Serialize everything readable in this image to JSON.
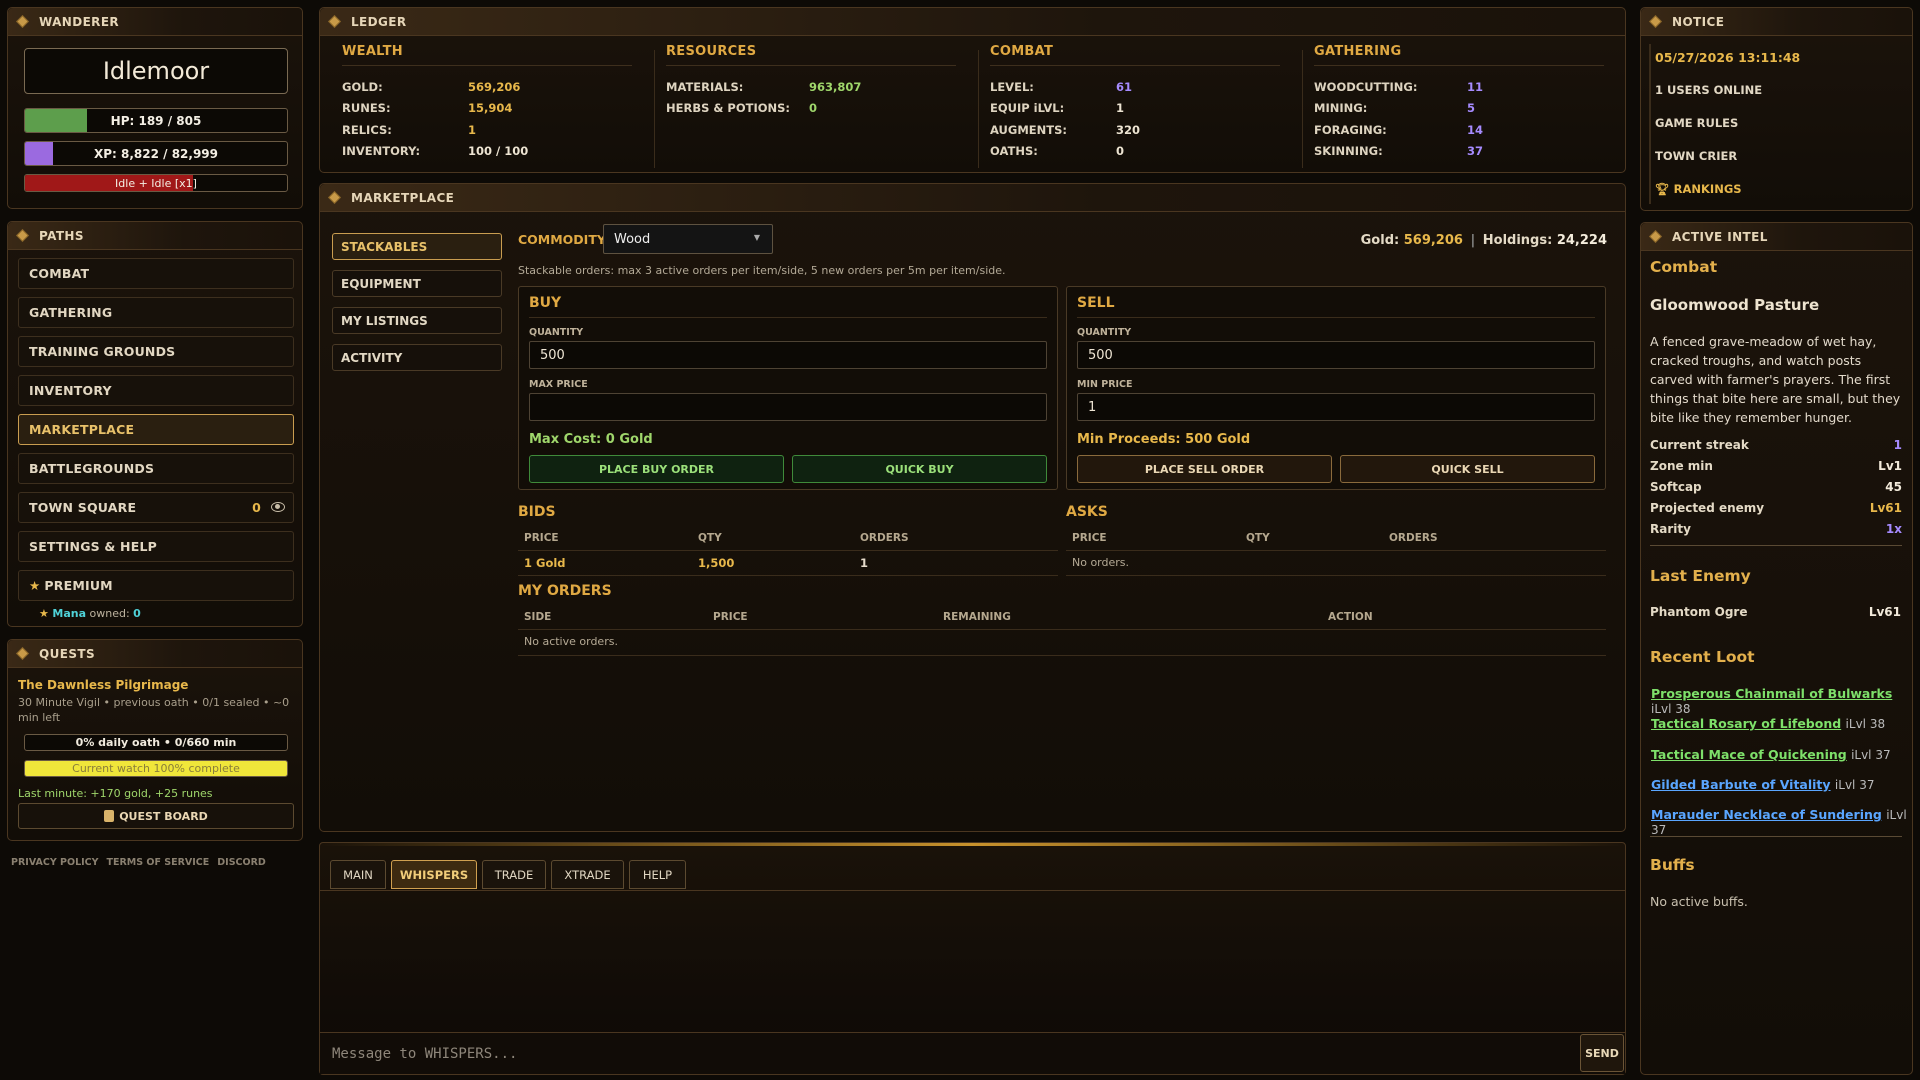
{
  "wanderer": {
    "title": "WANDERER",
    "name": "Idlemoor",
    "hp_text": "HP: 189 / 805",
    "hp_fraction": 0.235,
    "xp_text": "XP: 8,822 / 82,999",
    "xp_fraction": 0.106,
    "status_text": "Idle + Idle [x1]",
    "status_fraction": 0.64
  },
  "paths": {
    "title": "PATHS",
    "items": [
      {
        "label": "COMBAT"
      },
      {
        "label": "GATHERING"
      },
      {
        "label": "TRAINING GROUNDS"
      },
      {
        "label": "INVENTORY"
      },
      {
        "label": "MARKETPLACE",
        "active": true
      },
      {
        "label": "BATTLEGROUNDS"
      },
      {
        "label": "TOWN SQUARE",
        "count": "0"
      },
      {
        "label": "SETTINGS & HELP"
      },
      {
        "label": "PREMIUM"
      }
    ],
    "mana_label": "Mana",
    "mana_owned": "owned:",
    "mana_value": "0"
  },
  "quests": {
    "title": "QUESTS",
    "quest_name": "The Dawnless Pilgrimage",
    "quest_desc": "30 Minute Vigil • previous oath • 0/1 sealed • ~0 min left",
    "daily_text": "0% daily oath • 0/660 min",
    "watch_text": "Current watch 100% complete",
    "last_minute": "Last minute: +170 gold, +25 runes",
    "board_label": "QUEST BOARD"
  },
  "footer": {
    "privacy": "PRIVACY POLICY",
    "terms": "TERMS OF SERVICE",
    "discord": "DISCORD"
  },
  "ledger": {
    "title": "LEDGER",
    "wealth": {
      "title": "WEALTH",
      "rows": [
        {
          "k": "GOLD:",
          "v": "569,206"
        },
        {
          "k": "RUNES:",
          "v": "15,904"
        },
        {
          "k": "RELICS:",
          "v": "1"
        },
        {
          "k": "INVENTORY:",
          "v": "100 / 100"
        }
      ]
    },
    "resources": {
      "title": "RESOURCES",
      "rows": [
        {
          "k": "MATERIALS:",
          "v": "963,807"
        },
        {
          "k": "HERBS & POTIONS:",
          "v": "0"
        }
      ]
    },
    "combat": {
      "title": "COMBAT",
      "rows": [
        {
          "k": "LEVEL:",
          "v": "61"
        },
        {
          "k": "EQUIP iLVL:",
          "v": "1"
        },
        {
          "k": "AUGMENTS:",
          "v": "320"
        },
        {
          "k": "OATHS:",
          "v": "0"
        }
      ]
    },
    "gathering": {
      "title": "GATHERING",
      "rows": [
        {
          "k": "WOODCUTTING:",
          "v": "11"
        },
        {
          "k": "MINING:",
          "v": "5"
        },
        {
          "k": "FORAGING:",
          "v": "14"
        },
        {
          "k": "SKINNING:",
          "v": "37"
        }
      ]
    }
  },
  "market": {
    "title": "MARKETPLACE",
    "tabs": [
      "STACKABLES",
      "EQUIPMENT",
      "MY LISTINGS",
      "ACTIVITY"
    ],
    "commodity_label": "COMMODITY",
    "commodity_value": "Wood",
    "gold_label": "Gold:",
    "gold_value": "569,206",
    "holdings_label": "Holdings:",
    "holdings_value": "24,224",
    "note": "Stackable orders: max 3 active orders per item/side, 5 new orders per 5m per item/side.",
    "buy": {
      "title": "BUY",
      "qty_label": "QUANTITY",
      "qty_value": "500",
      "price_label": "MAX PRICE",
      "price_value": "",
      "summary": "Max Cost: 0 Gold",
      "place_btn": "PLACE BUY ORDER",
      "quick_btn": "QUICK BUY"
    },
    "sell": {
      "title": "SELL",
      "qty_label": "QUANTITY",
      "qty_value": "500",
      "price_label": "MIN PRICE",
      "price_value": "1",
      "summary": "Min Proceeds: 500 Gold",
      "place_btn": "PLACE SELL ORDER",
      "quick_btn": "QUICK SELL"
    },
    "bids": {
      "title": "BIDS",
      "cols": [
        "PRICE",
        "QTY",
        "ORDERS"
      ],
      "rows": [
        {
          "price": "1 Gold",
          "qty": "1,500",
          "orders": "1"
        }
      ]
    },
    "asks": {
      "title": "ASKS",
      "cols": [
        "PRICE",
        "QTY",
        "ORDERS"
      ],
      "empty": "No orders."
    },
    "my_orders": {
      "title": "MY ORDERS",
      "cols": [
        "SIDE",
        "PRICE",
        "REMAINING",
        "ACTION"
      ],
      "empty": "No active orders."
    }
  },
  "chat": {
    "tabs": [
      "MAIN",
      "WHISPERS",
      "TRADE",
      "XTRADE",
      "HELP"
    ],
    "active_tab": "WHISPERS",
    "placeholder": "Message to WHISPERS...",
    "send": "SEND"
  },
  "notice": {
    "title": "NOTICE",
    "datetime": "05/27/2026 13:11:48",
    "users_online": "1 USERS ONLINE",
    "game_rules": "GAME RULES",
    "town_crier": "TOWN CRIER",
    "rankings": "RANKINGS"
  },
  "intel": {
    "title": "ACTIVE INTEL",
    "section": "Combat",
    "zone": "Gloomwood Pasture",
    "desc": "A fenced grave-meadow of wet hay, cracked troughs, and watch posts carved with farmer's prayers. The first things that bite here are small, but they bite like they remember hunger.",
    "stats": [
      {
        "k": "Current streak",
        "v": "1"
      },
      {
        "k": "Zone min",
        "v": "Lv1"
      },
      {
        "k": "Softcap",
        "v": "45"
      },
      {
        "k": "Projected enemy",
        "v": "Lv61"
      },
      {
        "k": "Rarity",
        "v": "1x"
      }
    ],
    "last_enemy_title": "Last Enemy",
    "last_enemy_name": "Phantom Ogre",
    "last_enemy_level": "Lv61",
    "loot_title": "Recent Loot",
    "loot": [
      {
        "name": "Prosperous Chainmail of Bulwarks",
        "lvl": "iLvl 38",
        "color": "#7ee06a"
      },
      {
        "name": "Tactical Rosary of Lifebond",
        "lvl": "iLvl 38",
        "color": "#7ee06a"
      },
      {
        "name": "Tactical Mace of Quickening",
        "lvl": "iLvl 37",
        "color": "#7ee06a"
      },
      {
        "name": "Gilded Barbute of Vitality",
        "lvl": "iLvl 37",
        "color": "#5aa6ff"
      },
      {
        "name": "Marauder Necklace of Sundering",
        "lvl": "iLvl 37",
        "color": "#5aa6ff"
      }
    ],
    "buffs_title": "Buffs",
    "buffs_empty": "No active buffs."
  }
}
